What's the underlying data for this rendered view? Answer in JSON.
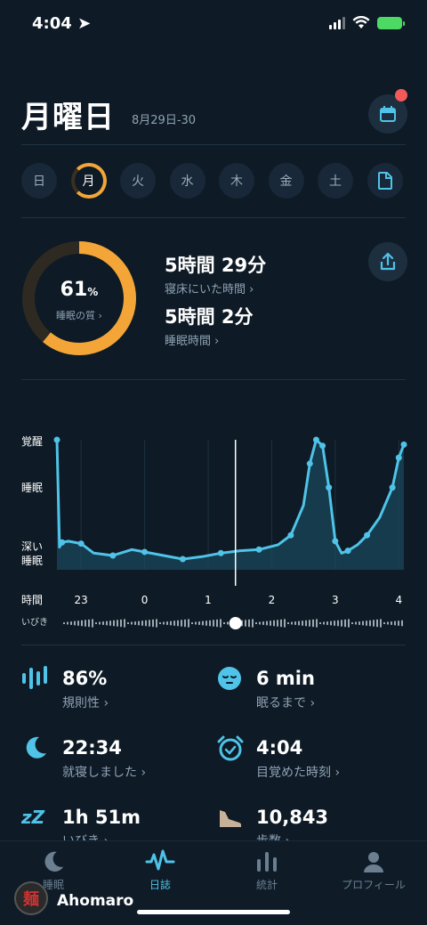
{
  "status_bar": {
    "time": "4:04"
  },
  "header": {
    "day": "月曜日",
    "date_range": "8月29日-30"
  },
  "days": [
    "日",
    "月",
    "火",
    "水",
    "木",
    "金",
    "土"
  ],
  "active_day_index": 1,
  "summary": {
    "quality_value": "61",
    "quality_unit": "%",
    "quality_label": "睡眠の質 ›",
    "quality_fraction": 0.61,
    "in_bed": "5時間 29分",
    "in_bed_label": "寝床にいた時間 ›",
    "asleep": "5時間 2分",
    "asleep_label": "睡眠時間 ›"
  },
  "chart": {
    "y_labels": {
      "awake": "覚醒",
      "sleep": "睡眠",
      "deep_1": "深い",
      "deep_2": "睡眠"
    },
    "x_title": "時間",
    "x_ticks": [
      "23",
      "0",
      "1",
      "2",
      "3",
      "4"
    ],
    "snore_label": "いびき"
  },
  "chart_data": {
    "type": "area",
    "x_unit": "hours",
    "x": [
      22.62,
      22.66,
      22.7,
      22.8,
      23.0,
      23.2,
      23.5,
      23.8,
      24.0,
      24.3,
      24.6,
      24.9,
      25.2,
      25.5,
      25.8,
      26.1,
      26.3,
      26.5,
      26.6,
      26.7,
      26.8,
      26.9,
      27.0,
      27.1,
      27.2,
      27.35,
      27.5,
      27.7,
      27.9,
      28.0,
      28.08
    ],
    "y": [
      1.0,
      0.1,
      0.14,
      0.15,
      0.13,
      0.05,
      0.03,
      0.08,
      0.06,
      0.03,
      0.0,
      0.02,
      0.05,
      0.07,
      0.08,
      0.12,
      0.2,
      0.45,
      0.8,
      1.0,
      0.95,
      0.6,
      0.15,
      0.05,
      0.07,
      0.12,
      0.2,
      0.35,
      0.6,
      0.85,
      0.96
    ],
    "y_levels": [
      "深い睡眠",
      "睡眠",
      "覚醒"
    ],
    "current_marker_x": 25.43
  },
  "metrics": [
    {
      "value": "86%",
      "label": "規則性 ›",
      "icon": "regularity-bars-icon"
    },
    {
      "value": "6 min",
      "label": "眠るまで ›",
      "icon": "sleepy-face-icon"
    },
    {
      "value": "22:34",
      "label": "就寝しました ›",
      "icon": "moon-icon"
    },
    {
      "value": "4:04",
      "label": "目覚めた時刻 ›",
      "icon": "alarm-clock-icon"
    },
    {
      "value": "1h 51m",
      "label": "いびき ›",
      "icon": "snore-zz-icon"
    },
    {
      "value": "10,843",
      "label": "歩数 ›",
      "icon": "shoe-icon"
    }
  ],
  "tabs": [
    {
      "label": "睡眠",
      "icon": "moon-icon"
    },
    {
      "label": "日誌",
      "icon": "wave-icon"
    },
    {
      "label": "統計",
      "icon": "stats-bars-icon"
    },
    {
      "label": "プロフィール",
      "icon": "person-icon"
    }
  ],
  "active_tab": 1,
  "user": {
    "name": "Ahomaro",
    "avatar_char": "麺"
  },
  "colors": {
    "accent": "#4fc3e8",
    "ring": "#f3a637",
    "background": "#0e1a25"
  }
}
